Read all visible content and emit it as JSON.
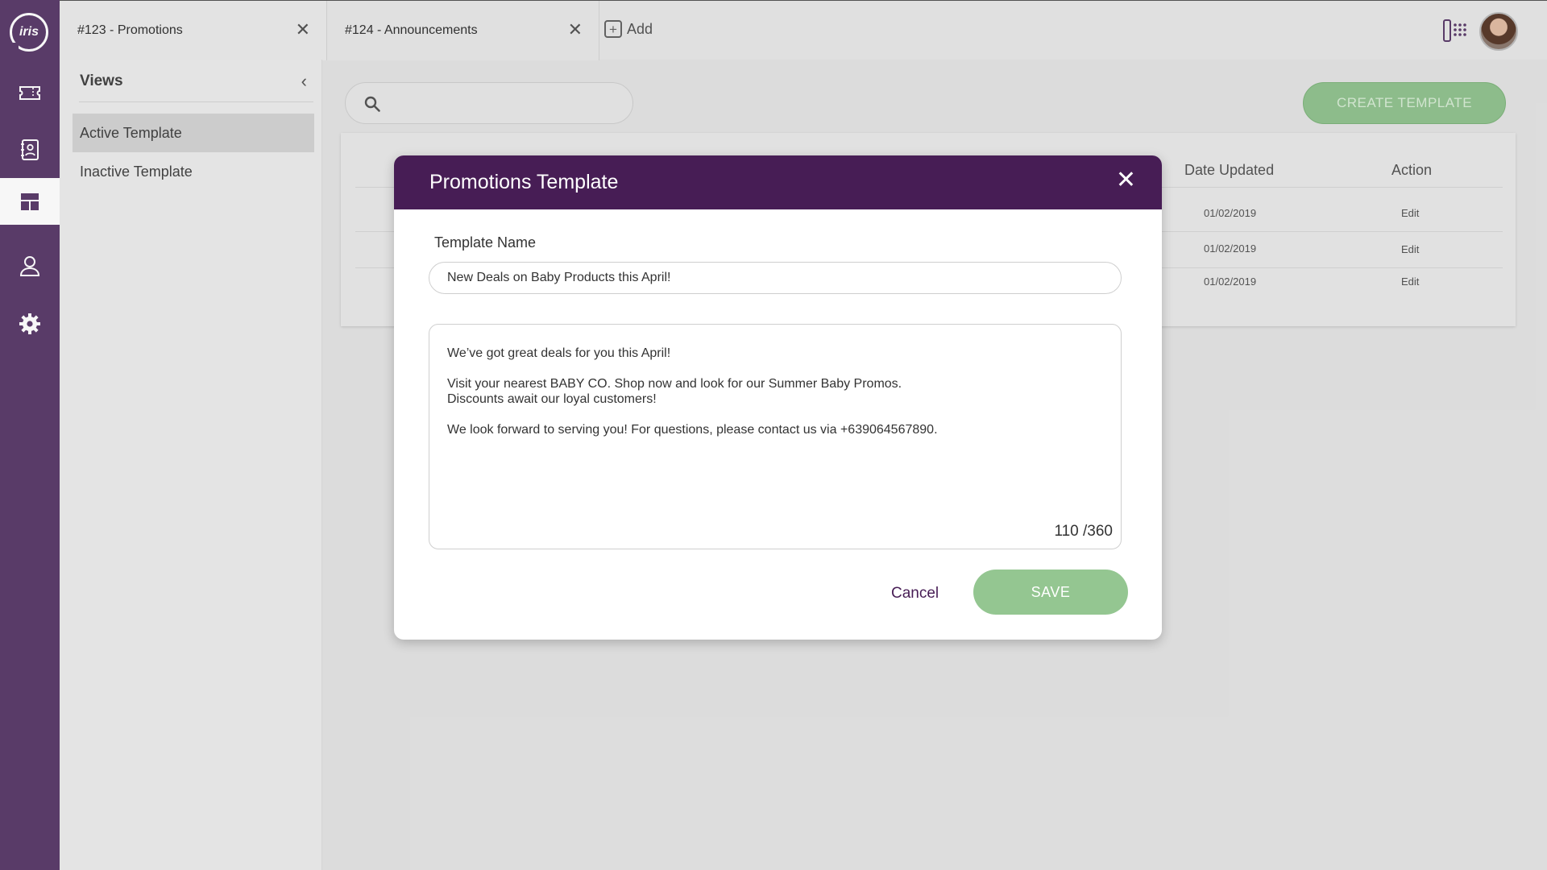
{
  "app": {
    "logo_text": "iris"
  },
  "rail": {
    "items": [
      {
        "icon": "ticket-icon"
      },
      {
        "icon": "contacts-book-icon"
      },
      {
        "icon": "templates-icon"
      },
      {
        "icon": "user-icon"
      },
      {
        "icon": "gear-icon"
      }
    ],
    "active_index": 2
  },
  "tabs": [
    {
      "label": "#123 - Promotions"
    },
    {
      "label": "#124 - Announcements"
    }
  ],
  "add_tab_label": "Add",
  "views": {
    "title": "Views",
    "items": [
      {
        "label": "Active Template"
      },
      {
        "label": "Inactive Template"
      }
    ]
  },
  "toolbar": {
    "search_placeholder": "",
    "create_label": "CREATE TEMPLATE"
  },
  "table": {
    "headers": {
      "date_updated": "Date Updated",
      "action": "Action"
    },
    "rows": [
      {
        "date": "01/02/2019",
        "action": "Edit"
      },
      {
        "date": "01/02/2019",
        "action": "Edit"
      },
      {
        "date": "01/02/2019",
        "action": "Edit"
      }
    ]
  },
  "modal": {
    "title": "Promotions Template",
    "name_label": "Template Name",
    "name_value": "New Deals on Baby Products this April!",
    "body_lines": [
      "We’ve got great deals for you this April!",
      "",
      "Visit your nearest BABY CO. Shop now and look for our Summer Baby Promos.",
      "Discounts await our loyal customers!",
      "",
      "We look forward to serving you! For questions, please contact us via +639064567890."
    ],
    "char_count": "110 /360",
    "cancel_label": "Cancel",
    "save_label": "SAVE"
  },
  "colors": {
    "rail": "#5c3d6c",
    "modal_header": "#471d55",
    "primary_button": "#94c691"
  }
}
